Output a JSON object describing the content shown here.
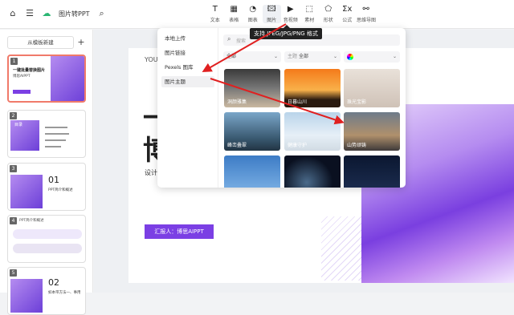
{
  "topbar": {
    "title": "图片转PPT",
    "tools": [
      {
        "label": "文本",
        "icon": "T"
      },
      {
        "label": "表格",
        "icon": "▦"
      },
      {
        "label": "图表",
        "icon": "◔"
      },
      {
        "label": "图片",
        "icon": "🖾"
      },
      {
        "label": "音视频",
        "icon": "▶"
      },
      {
        "label": "素材",
        "icon": "⬚"
      },
      {
        "label": "形状",
        "icon": "⬠"
      },
      {
        "label": "公式",
        "icon": "Σx"
      },
      {
        "label": "思维导图",
        "icon": "⚯"
      }
    ]
  },
  "leftpanel": {
    "new_label": "从模板新建",
    "add_label": "+",
    "slides": [
      {
        "num": "1",
        "title": "一键批量替换图片",
        "sub": "博思AIPPT"
      },
      {
        "num": "2",
        "title": "目录"
      },
      {
        "num": "3",
        "big": "01",
        "sub": "PPT简介和概述"
      },
      {
        "num": "4",
        "title": "PPT简介和概述"
      },
      {
        "num": "5",
        "big": "02",
        "sub": "如本带方法一、事用"
      }
    ]
  },
  "slide": {
    "you": "YOU",
    "big1": "一",
    "big2": "博",
    "sub": "设计",
    "reporter": "汇报人：博思AIPPT"
  },
  "popup": {
    "menu": [
      {
        "label": "本地上传"
      },
      {
        "label": "图片链接"
      },
      {
        "label": "Pexels 图库"
      },
      {
        "label": "图片主题"
      }
    ],
    "search_placeholder": "搜索",
    "filter1": "全部",
    "filter2": "全部",
    "filter2_prefix": "主题",
    "images": [
      {
        "caption": "洞颜雅集",
        "bg": "linear-gradient(180deg,#3a3a3a,#777,#c9b8a0)"
      },
      {
        "caption": "日暮山川",
        "bg": "linear-gradient(180deg,#f47a1a,#f9b14a 55%,#2a1a10 80%)"
      },
      {
        "caption": "珠光宝影",
        "bg": "linear-gradient(180deg,#e9e1d9,#cfc2b7)"
      },
      {
        "caption": "峰峦叠翠",
        "bg": "linear-gradient(180deg,#7aa6c9,#38576e 70%,#223443)"
      },
      {
        "caption": "健康守护",
        "bg": "linear-gradient(180deg,#b9d4ea,#e6eff7 60%,#d1dbe4)"
      },
      {
        "caption": "山势顽铸",
        "bg": "linear-gradient(180deg,#6e7b8a,#b0906c 60%,#3e3a3a)"
      },
      {
        "caption": "",
        "bg": "linear-gradient(180deg,#3d7cc6,#7fb3e6)"
      },
      {
        "caption": "",
        "bg": "radial-gradient(circle at 40% 70%,#4a6a8a,#0a1020 60%)"
      },
      {
        "caption": "",
        "bg": "linear-gradient(180deg,#0b1730,#1d2e52)"
      }
    ]
  },
  "tooltip": "支持 JPEG/JPG/PNG 格式",
  "colors": {
    "accent": "#7b3fe4",
    "arrow": "#e02020"
  }
}
